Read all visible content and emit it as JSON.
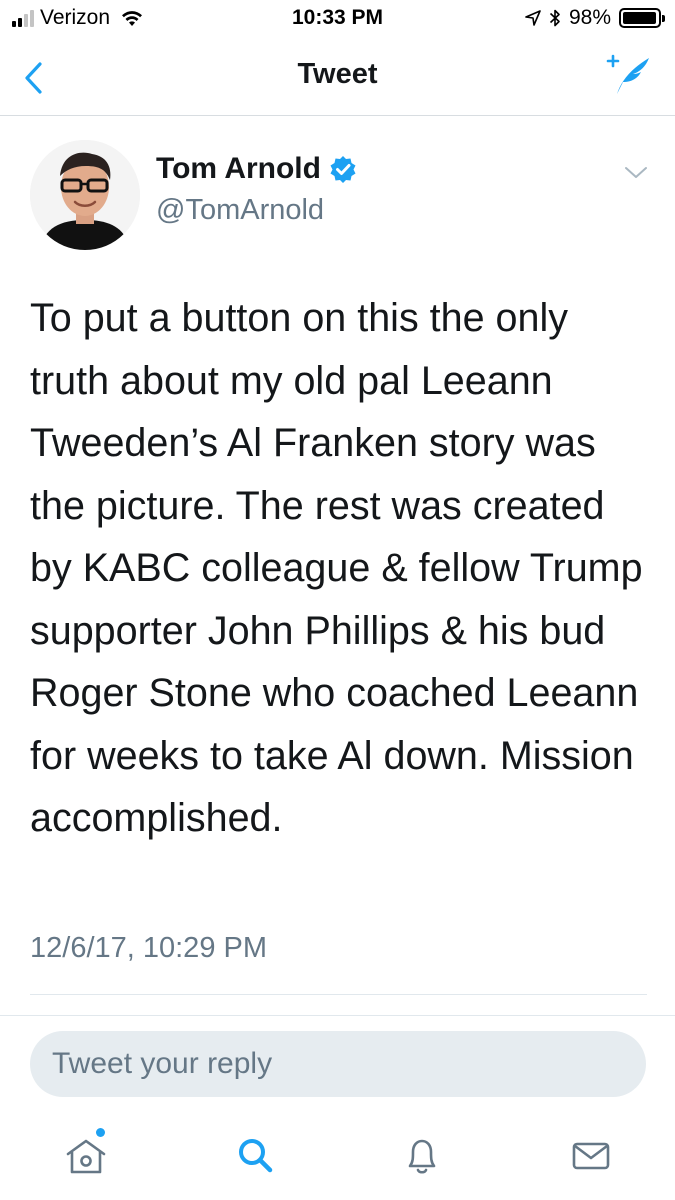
{
  "status_bar": {
    "carrier": "Verizon",
    "time": "10:33 PM",
    "battery_percent": "98%",
    "battery_level": 0.98,
    "signal_bars_active": 2,
    "signal_bars_total": 4
  },
  "nav": {
    "title": "Tweet",
    "back_icon": "chevron-left-icon",
    "compose_icon": "compose-tweet-icon"
  },
  "tweet": {
    "author_name": "Tom Arnold",
    "author_handle": "@TomArnold",
    "verified": true,
    "text": "To put a button on this the only truth about my old pal Leeann Tweeden’s Al Franken story was the picture. The rest was created by KABC colleague & fellow Trump supporter John Phillips & his bud Roger Stone who coached Leeann for weeks to take Al down. Mission accomplished.",
    "timestamp": "12/6/17, 10:29 PM"
  },
  "reply": {
    "placeholder": "Tweet your reply"
  },
  "tab_bar": {
    "items": [
      {
        "icon": "home-icon",
        "active": false,
        "has_notification_dot": true
      },
      {
        "icon": "search-icon",
        "active": true
      },
      {
        "icon": "bell-icon",
        "active": false
      },
      {
        "icon": "mail-icon",
        "active": false
      }
    ]
  },
  "colors": {
    "accent": "#1da1f2",
    "text_primary": "#14171a",
    "text_secondary": "#657786",
    "divider": "#e1e8ed",
    "reply_bg": "#e6ecf0"
  }
}
